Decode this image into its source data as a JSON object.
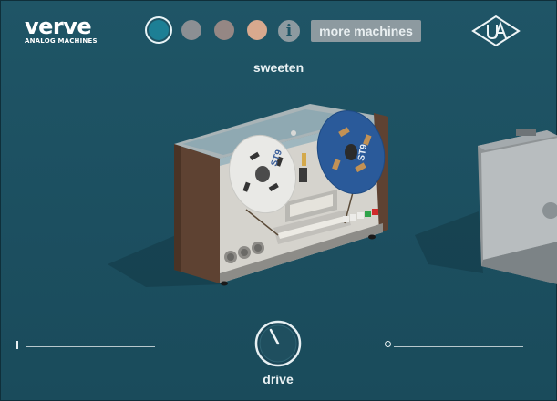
{
  "brand": {
    "word": "verve",
    "subtitle": "ANALOG MACHINES"
  },
  "swatches": [
    {
      "name": "teal",
      "color": "#1d7f95",
      "selected": true
    },
    {
      "name": "gray",
      "color": "#8c8f93",
      "selected": false
    },
    {
      "name": "taupe",
      "color": "#958784",
      "selected": false
    },
    {
      "name": "peach",
      "color": "#d8a98e",
      "selected": false
    }
  ],
  "info_label": "i",
  "more_machines_label": "more machines",
  "preset_name": "sweeten",
  "reel_label": "ST9",
  "controls": {
    "left_slider_value": 0,
    "right_slider_value": 0,
    "drive_label": "drive",
    "drive_value": 0.2
  },
  "colors": {
    "background": "#1f5566",
    "accent": "#1d7f95"
  },
  "icons": {
    "info": "info-icon",
    "ua_logo": "ua-logo-icon"
  }
}
